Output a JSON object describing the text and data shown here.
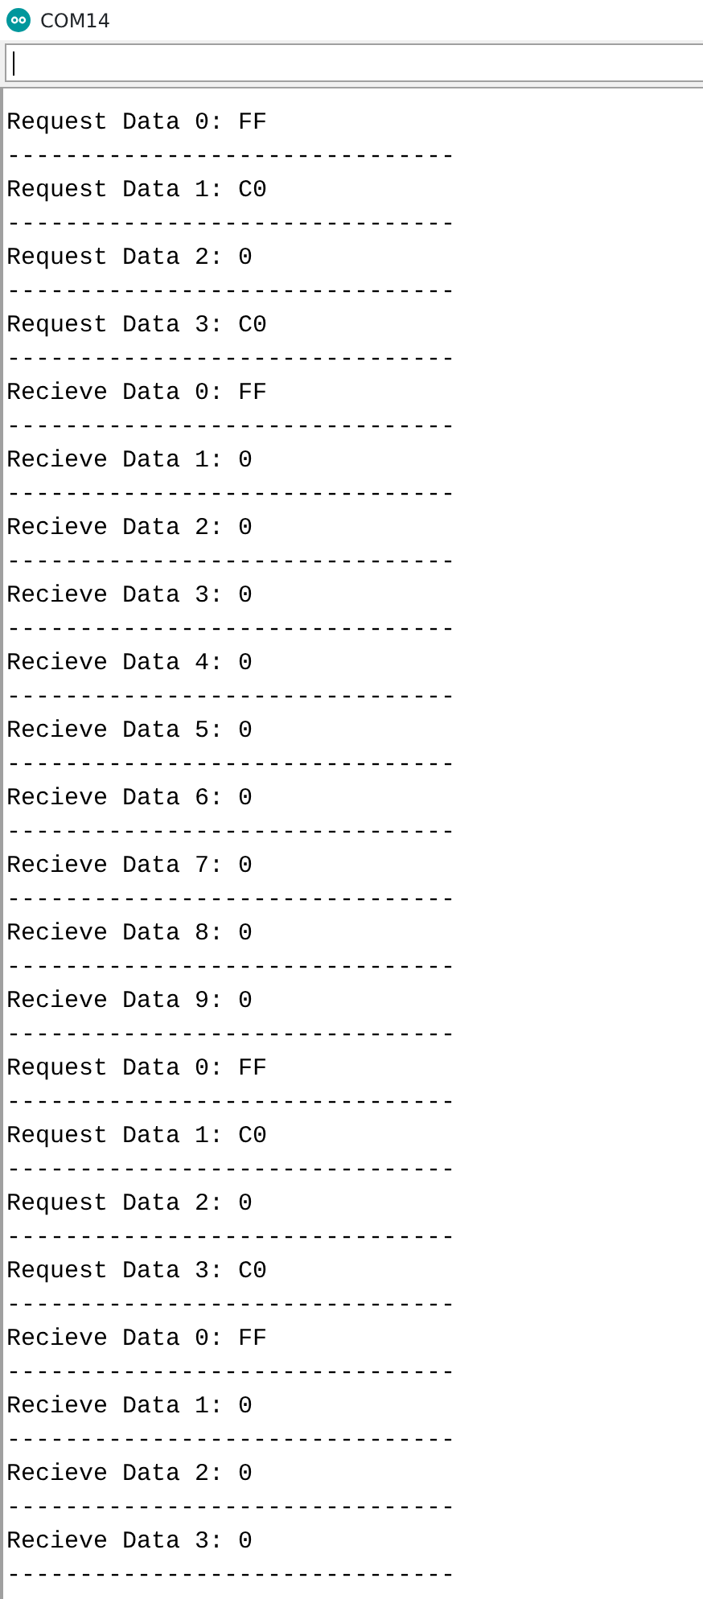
{
  "window": {
    "title": "COM14"
  },
  "output": [
    {
      "text": "Request Data 0: FF",
      "rule": "-------------------------------"
    },
    {
      "text": "Request Data 1: C0",
      "rule": "-------------------------------"
    },
    {
      "text": "Request Data 2: 0",
      "rule": "-------------------------------"
    },
    {
      "text": "Request Data 3: C0",
      "rule": "-------------------------------"
    },
    {
      "text": "Recieve Data 0: FF",
      "rule": "-------------------------------"
    },
    {
      "text": "Recieve Data 1: 0",
      "rule": "-------------------------------"
    },
    {
      "text": "Recieve Data 2: 0",
      "rule": "-------------------------------"
    },
    {
      "text": "Recieve Data 3: 0",
      "rule": "-------------------------------"
    },
    {
      "text": "Recieve Data 4: 0",
      "rule": "-------------------------------"
    },
    {
      "text": "Recieve Data 5: 0",
      "rule": "-------------------------------"
    },
    {
      "text": "Recieve Data 6: 0",
      "rule": "-------------------------------"
    },
    {
      "text": "Recieve Data 7: 0",
      "rule": "-------------------------------"
    },
    {
      "text": "Recieve Data 8: 0",
      "rule": "-------------------------------"
    },
    {
      "text": "Recieve Data 9: 0",
      "rule": "-------------------------------"
    },
    {
      "text": "Request Data 0: FF",
      "rule": "-------------------------------"
    },
    {
      "text": "Request Data 1: C0",
      "rule": "-------------------------------"
    },
    {
      "text": "Request Data 2: 0",
      "rule": "-------------------------------"
    },
    {
      "text": "Request Data 3: C0",
      "rule": "-------------------------------"
    },
    {
      "text": "Recieve Data 0: FF",
      "rule": "-------------------------------"
    },
    {
      "text": "Recieve Data 1: 0",
      "rule": "-------------------------------"
    },
    {
      "text": "Recieve Data 2: 0",
      "rule": "-------------------------------"
    },
    {
      "text": "Recieve Data 3: 0",
      "rule": "-------------------------------"
    }
  ]
}
